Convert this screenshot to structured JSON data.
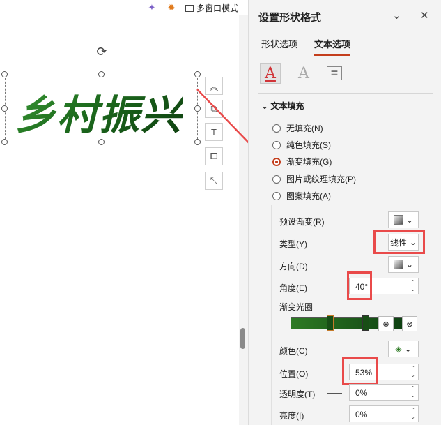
{
  "topbar": {
    "wand_icon": "wand-icon",
    "gear_icon": "gear-icon",
    "multiwindow_label": "多窗口模式"
  },
  "canvas": {
    "wordart_text": "乡村振兴",
    "rotate_icon": "rotate-icon"
  },
  "side_tools": [
    "chevron-up-icon",
    "crop-icon",
    "text-box-icon",
    "shape-arrange-icon",
    "resize-icon"
  ],
  "panel": {
    "title": "设置形状格式",
    "tabs": [
      {
        "label": "形状选项"
      },
      {
        "label": "文本选项"
      }
    ],
    "icon_tabs": [
      {
        "glyph": "A"
      },
      {
        "glyph": "A"
      },
      {
        "glyph": "≡"
      }
    ],
    "section_title": "文本填充",
    "fill_options": [
      {
        "label": "无填充(N)"
      },
      {
        "label": "纯色填充(S)"
      },
      {
        "label": "渐变填充(G)"
      },
      {
        "label": "图片或纹理填充(P)"
      },
      {
        "label": "图案填充(A)"
      }
    ],
    "selected_fill": "渐变填充(G)",
    "preset_label": "预设渐变(R)",
    "type_label": "类型(Y)",
    "type_value": "线性",
    "direction_label": "方向(D)",
    "angle_label": "角度(E)",
    "angle_value": "40°",
    "stops_label": "渐变光圈",
    "color_label": "颜色(C)",
    "position_label": "位置(O)",
    "position_value": "53%",
    "transparency_label": "透明度(T)",
    "transparency_value": "0%",
    "brightness_label": "亮度(I)",
    "brightness_value": "0%",
    "accent_color": "#c43e1c",
    "highlight_color": "#e94a4a"
  }
}
